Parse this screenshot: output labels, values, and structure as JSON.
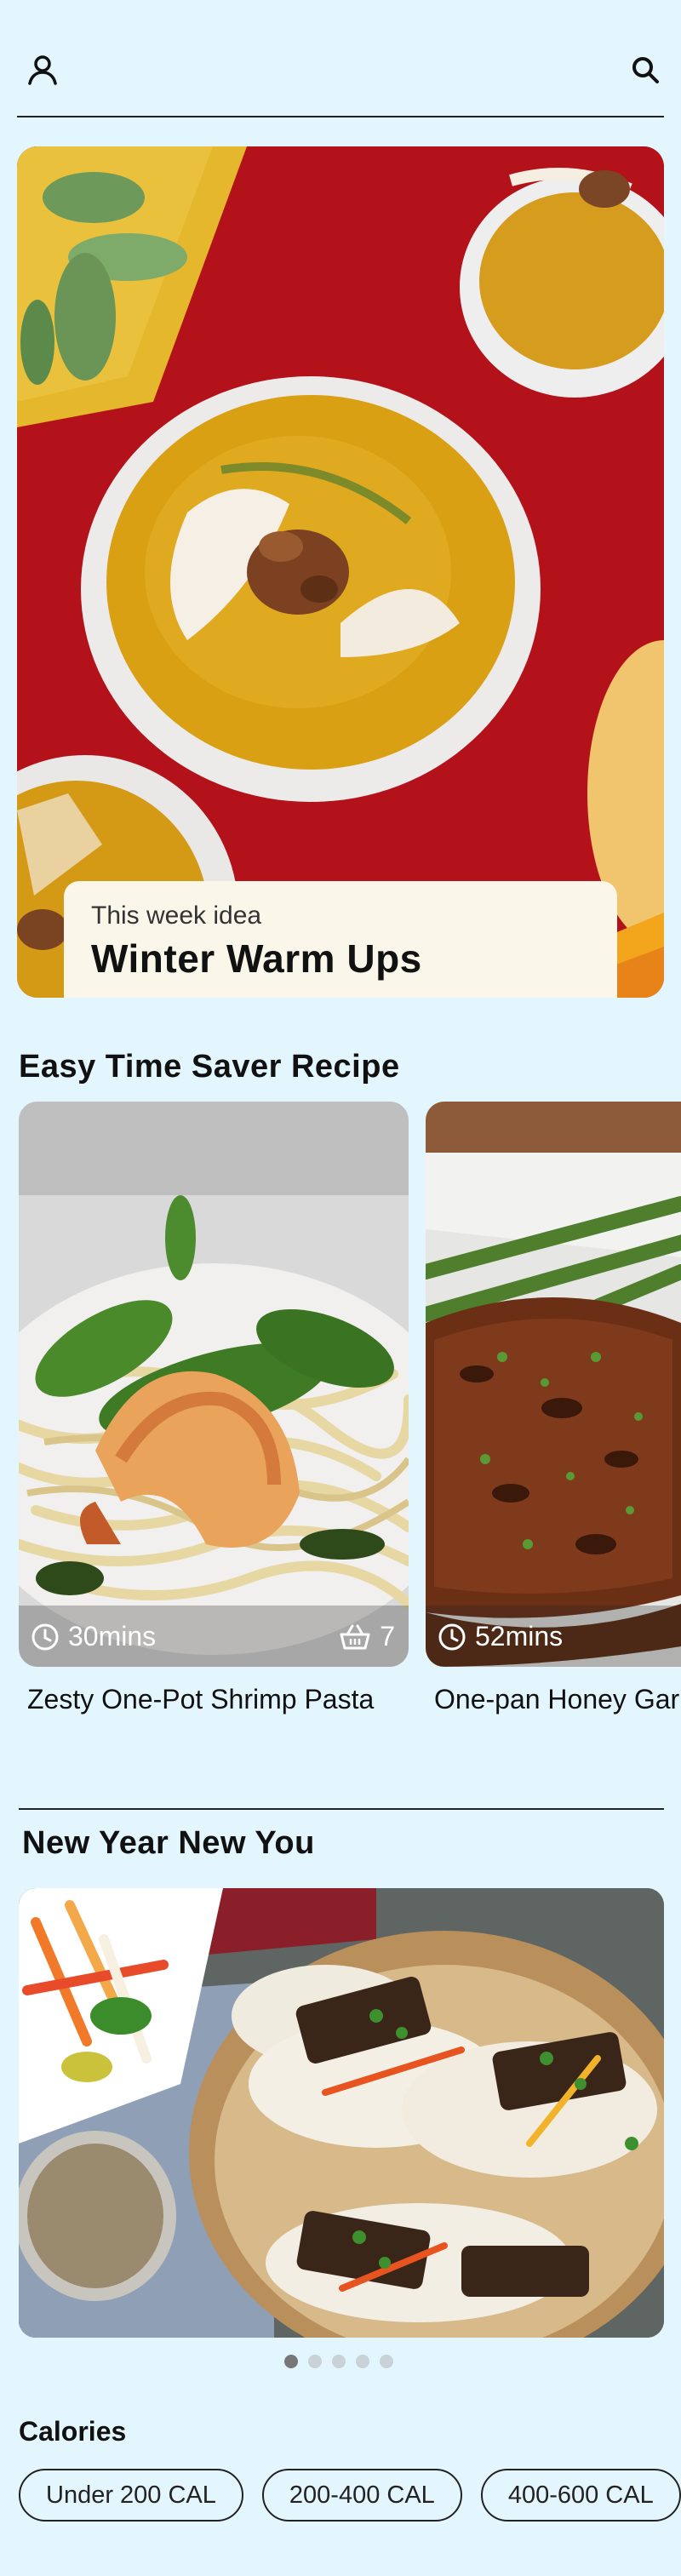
{
  "header": {
    "profile_icon": "profile-icon",
    "search_icon": "search-icon"
  },
  "hero": {
    "subtitle": "This week idea",
    "title": "Winter Warm Ups"
  },
  "sections": {
    "easy_title": "Easy Time Saver Recipe",
    "new_year_title": "New Year New You",
    "calories_title": "Calories"
  },
  "recipes": [
    {
      "name": "Zesty One-Pot Shrimp Pasta",
      "time": "30mins",
      "servings": "7"
    },
    {
      "name": "One-pan Honey Garlic Chicken",
      "time": "52mins"
    }
  ],
  "carousel": {
    "count": 5,
    "active": 1
  },
  "calorie_filters": [
    "Under 200 CAL",
    "200-400 CAL",
    "400-600 CAL"
  ],
  "colors": {
    "background": "#e3f5fd",
    "hero_card": "#fbf6ea",
    "text": "#111111"
  }
}
